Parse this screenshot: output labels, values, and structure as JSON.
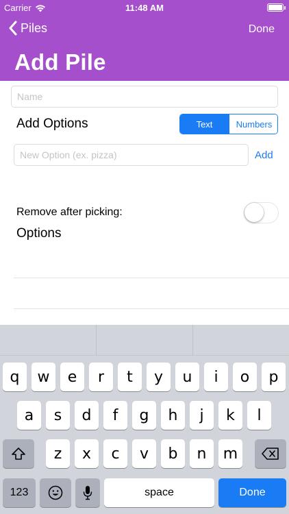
{
  "status_bar": {
    "carrier": "Carrier",
    "time": "11:48 AM"
  },
  "nav": {
    "back_label": "Piles",
    "done_label": "Done",
    "title": "Add Pile"
  },
  "form": {
    "name_placeholder": "Name",
    "add_options_label": "Add Options",
    "segments": [
      "Text",
      "Numbers"
    ],
    "selected_segment": "Text",
    "option_placeholder": "New Option (ex. pizza)",
    "add_button": "Add",
    "remove_label": "Remove after picking:",
    "remove_toggle_on": false,
    "options_heading": "Options"
  },
  "keyboard": {
    "row1": [
      "q",
      "w",
      "e",
      "r",
      "t",
      "y",
      "u",
      "i",
      "o",
      "p"
    ],
    "row2": [
      "a",
      "s",
      "d",
      "f",
      "g",
      "h",
      "j",
      "k",
      "l"
    ],
    "row3": [
      "z",
      "x",
      "c",
      "v",
      "b",
      "n",
      "m"
    ],
    "numbers_key": "123",
    "space_key": "space",
    "done_key": "Done"
  },
  "colors": {
    "header": "#a64fcc",
    "accent": "#1a7cf5",
    "keyboard_bg": "#d1d4da"
  }
}
